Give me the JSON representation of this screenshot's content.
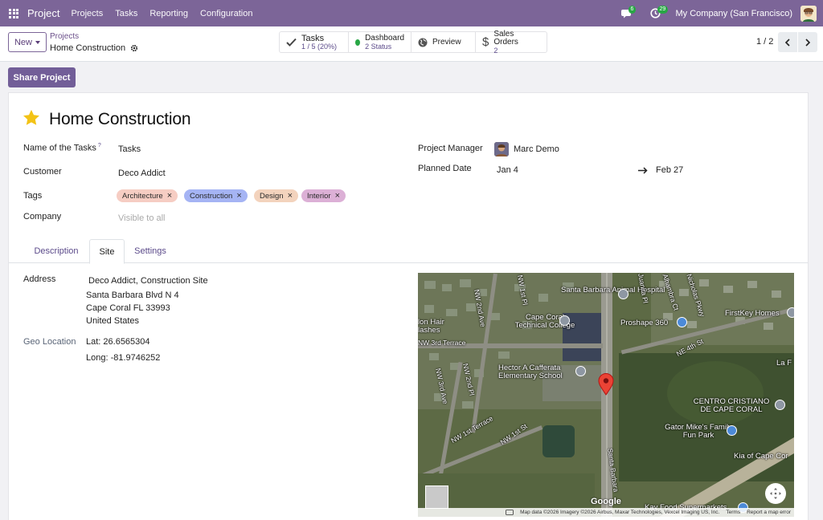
{
  "navbar": {
    "brand": "Project",
    "menus": [
      "Projects",
      "Tasks",
      "Reporting",
      "Configuration"
    ],
    "chat_count": "6",
    "activity_count": "29",
    "company": "My Company (San Francisco)"
  },
  "control": {
    "new_label": "New",
    "breadcrumb_parent": "Projects",
    "breadcrumb_current": "Home Construction",
    "smart_buttons": {
      "tasks_title": "Tasks",
      "tasks_value": "1 / 5 (20%)",
      "dashboard_title": "Dashboard",
      "dashboard_value": "2 Status",
      "preview_title": "Preview",
      "sales_title": "Sales Orders",
      "sales_value": "2"
    },
    "pager": "1 / 2"
  },
  "share_label": "Share Project",
  "form": {
    "title": "Home Construction",
    "task_name_label": "Name of the Tasks",
    "task_name_help": "?",
    "task_name_value": "Tasks",
    "customer_label": "Customer",
    "customer_value": "Deco Addict",
    "tags_label": "Tags",
    "tags": [
      {
        "name": "Architecture",
        "color": "#f6cdc3"
      },
      {
        "name": "Construction",
        "color": "#a5b4f4"
      },
      {
        "name": "Design",
        "color": "#f3d3bd"
      },
      {
        "name": "Interior",
        "color": "#dcb0d6"
      }
    ],
    "company_label": "Company",
    "company_placeholder": "Visible to all",
    "manager_label": "Project Manager",
    "manager_value": "Marc Demo",
    "planned_label": "Planned Date",
    "planned_start": "Jan 4",
    "planned_end": "Feb 27"
  },
  "tabs": [
    "Description",
    "Site",
    "Settings"
  ],
  "site": {
    "address_label": "Address",
    "address_lines": [
      "Deco Addict, Construction Site",
      "Santa Barbara Blvd N 4",
      "Cape Coral FL 33993",
      "United States"
    ],
    "geo_label": "Geo Location",
    "lat": "Lat: 26.6565304",
    "long": "Long: -81.9746252"
  },
  "map": {
    "labels": [
      "Santa Barbara Animal Hospital",
      "Cape Coral Technical College",
      "Proshape 360",
      "FirstKey Homes",
      "Hector A Cafferata Elementary School",
      "CENTRO CRISTIANO DE CAPE CORAL",
      "Gator Mike's Family Fun Park",
      "Kia of Cape Cor",
      "La F",
      "lon Hair lashes",
      "Kay Food Supermarkets"
    ],
    "roads": [
      "NW 3rd Terrace",
      "NW 2nd Ave",
      "NW 1st Pl",
      "NE 4th St",
      "NW 3rd Ave",
      "NW 2nd Pl",
      "NW 1st Terrace",
      "NW 1st St",
      "Santa Barbara",
      "Juanita Pl",
      "Alhambra Ct",
      "Nicholas Pkwy"
    ],
    "google": "Google",
    "footer": [
      "Map data ©2026 Imagery ©2026 Airbus, Maxar Technologies, Vexcel Imaging US, Inc.",
      "Terms",
      "Report a map error"
    ]
  },
  "colors": {
    "navbar": "#7c6598",
    "accent": "#725e98",
    "star": "#f3c316"
  }
}
